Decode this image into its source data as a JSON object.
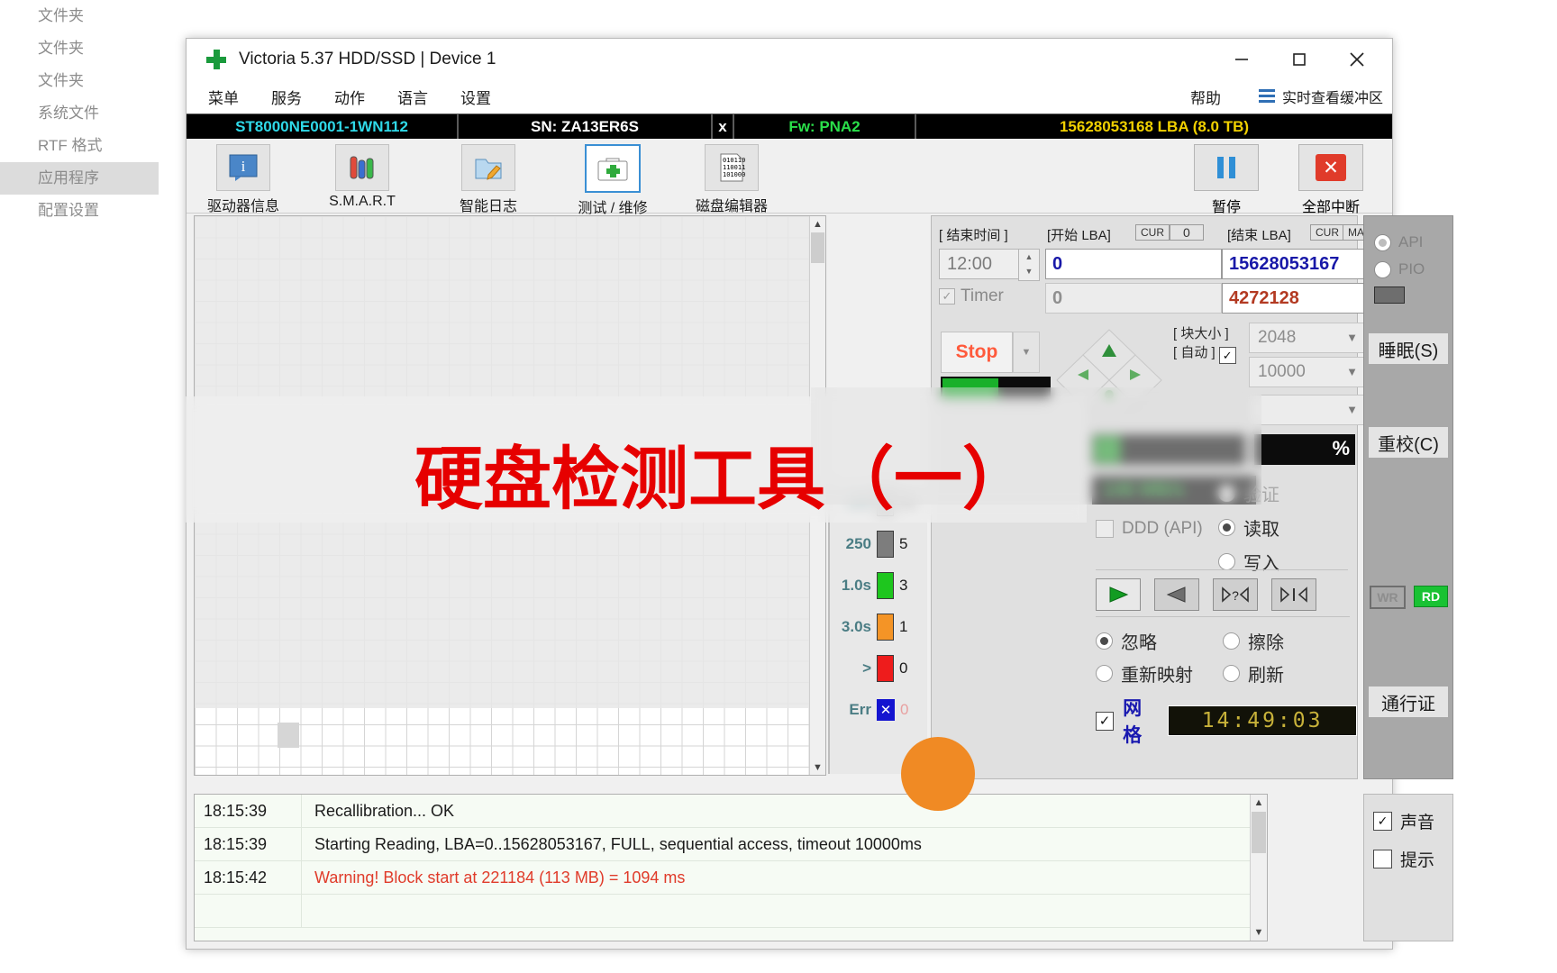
{
  "background_list": {
    "items": [
      {
        "label": "文件夹",
        "selected": false
      },
      {
        "label": "文件夹",
        "selected": false
      },
      {
        "label": "文件夹",
        "selected": false
      },
      {
        "label": "系统文件",
        "selected": false
      },
      {
        "label": "RTF 格式",
        "selected": false
      },
      {
        "label": "应用程序",
        "selected": true
      },
      {
        "label": "配置设置",
        "selected": false
      }
    ]
  },
  "window": {
    "title": "Victoria 5.37 HDD/SSD | Device 1",
    "app_icon": "green-cross-icon",
    "minimize": "–",
    "maximize": "□",
    "close": "✕"
  },
  "menu": {
    "items": [
      "菜单",
      "服务",
      "动作",
      "语言",
      "设置"
    ],
    "help": "帮助",
    "buffer_label": "实时查看缓冲区",
    "buffer_icon": "list-lines-icon"
  },
  "device_strip": {
    "model": "ST8000NE0001-1WN112",
    "serial": "SN: ZA13ER6S",
    "x_button": "x",
    "firmware": "Fw: PNA2",
    "capacity": "15628053168 LBA (8.0 TB)"
  },
  "toolbar": {
    "buttons": [
      {
        "label": "驱动器信息",
        "icon": "info-bubble-icon",
        "active": false
      },
      {
        "label": "S.M.A.R.T",
        "icon": "test-tubes-icon",
        "active": false
      },
      {
        "label": "智能日志",
        "icon": "folder-pencil-icon",
        "active": false
      },
      {
        "label": "测试 / 维修",
        "icon": "first-aid-kit-icon",
        "active": true
      },
      {
        "label": "磁盘编辑器",
        "icon": "binary-page-icon",
        "active": false
      }
    ],
    "pause": {
      "label": "暂停",
      "icon": "pause-icon"
    },
    "stop_all": {
      "label": "全部中断",
      "icon": "red-x-icon"
    }
  },
  "controls": {
    "end_time_label": "[ 结束时间 ]",
    "end_time_value": "12:00",
    "start_lba_label": "[开始 LBA]",
    "start_lba_cur": "CUR",
    "start_lba_cur_value": "0",
    "start_lba_value": "0",
    "end_lba_label": "[结束 LBA]",
    "end_lba_cur": "CUR",
    "end_lba_max": "MAX",
    "end_lba_value": "15628053167",
    "timer_label": "Timer",
    "timer_value": "0",
    "current_lba_value": "4272128",
    "stop_label": "Stop",
    "block_size_label": "[ 块大小 ]",
    "auto_label": "[ 自动 ]",
    "block_size_value": "2048",
    "timeout_value": "10000",
    "mode_value": "",
    "progress_percent": "%",
    "speed_value": "146 MB/s",
    "ddd_label": "DDD (API)",
    "rw_modes": [
      {
        "label": "验证",
        "selected": false,
        "dim": true
      },
      {
        "label": "读取",
        "selected": true,
        "dim": false
      },
      {
        "label": "写入",
        "selected": false,
        "dim": false
      }
    ],
    "nav_buttons": [
      {
        "name": "play-button",
        "glyph": "▶"
      },
      {
        "name": "reverse-button",
        "glyph": "◀"
      },
      {
        "name": "scan-unknown-button",
        "glyph": "▷?◁"
      },
      {
        "name": "step-button",
        "glyph": "▷|◁"
      }
    ],
    "bad_block_actions": [
      {
        "label": "忽略",
        "selected": true
      },
      {
        "label": "擦除",
        "selected": false
      },
      {
        "label": "重新映射",
        "selected": false
      },
      {
        "label": "刷新",
        "selected": false
      }
    ],
    "grid_label": "网格",
    "clock": "14:49:03"
  },
  "legend": {
    "rows": [
      {
        "left": "100",
        "color": "#c9c9c9",
        "right": "25"
      },
      {
        "left": "250",
        "color": "#7d7d7d",
        "right": "5"
      },
      {
        "left": "1.0s",
        "color": "#1ec61e",
        "right": "3"
      },
      {
        "left": "3.0s",
        "color": "#f49426",
        "right": "1"
      },
      {
        "left": ">",
        "color": "#ee1c1c",
        "right": "0"
      },
      {
        "left": "Err",
        "color": "#1414d0",
        "right": "0"
      }
    ]
  },
  "sidebar": {
    "api_label": "API",
    "pio_label": "PIO",
    "sleep_label": "睡眠(S)",
    "recal_label": "重校(C)",
    "pass_label": "通行证",
    "wr_tag": "WR",
    "rd_tag": "RD"
  },
  "log": {
    "rows": [
      {
        "time": "18:15:39",
        "message": "Recallibration... OK",
        "warn": false
      },
      {
        "time": "18:15:39",
        "message": "Starting Reading, LBA=0..15628053167, FULL, sequential access, timeout 10000ms",
        "warn": false
      },
      {
        "time": "18:15:42",
        "message": "Warning! Block start at 221184 (113 MB)  = 1094 ms",
        "warn": true
      }
    ]
  },
  "bottom_right": {
    "sound_label": "声音",
    "hint_label": "提示"
  },
  "overlay": {
    "headline": "硬盘检测工具（一）",
    "headline_color": "#e60000"
  }
}
